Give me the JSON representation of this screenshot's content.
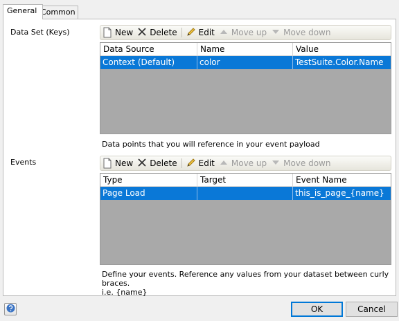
{
  "tabs": {
    "general": "General",
    "common": "Common"
  },
  "dataset": {
    "label": "Data Set (Keys)",
    "toolbar": {
      "new": "New",
      "delete": "Delete",
      "edit": "Edit",
      "move_up": "Move up",
      "move_down": "Move down"
    },
    "columns": [
      "Data Source",
      "Name",
      "Value"
    ],
    "rows": [
      [
        "Context (Default)",
        "color",
        "TestSuite.Color.Name"
      ]
    ],
    "help": "Data points that you will reference in your event payload"
  },
  "events": {
    "label": "Events",
    "toolbar": {
      "new": "New",
      "delete": "Delete",
      "edit": "Edit",
      "move_up": "Move up",
      "move_down": "Move down"
    },
    "columns": [
      "Type",
      "Target",
      "Event Name"
    ],
    "rows": [
      [
        "Page Load",
        "",
        "this_is_page_{name}"
      ]
    ],
    "help_line1": "Define your events. Reference any values from your dataset between curly braces.",
    "help_line2": "i.e. {name}"
  },
  "buttons": {
    "ok": "OK",
    "cancel": "Cancel"
  },
  "colors": {
    "selection": "#0a78d7",
    "grid_empty": "#a9a9a9",
    "ok_border": "#0078d7"
  }
}
